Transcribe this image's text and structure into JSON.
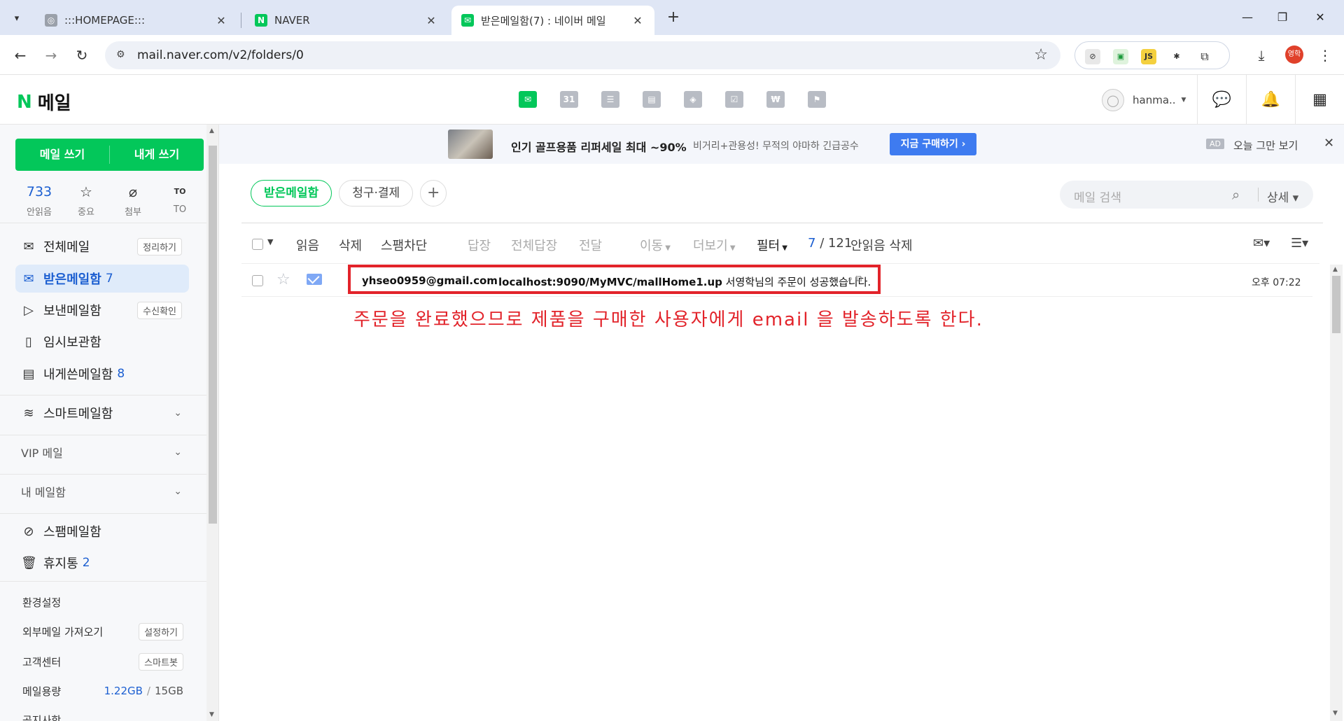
{
  "browser": {
    "tabs": [
      {
        "title": ":::HOMEPAGE:::",
        "favicon": "globe-icon"
      },
      {
        "title": "NAVER",
        "favicon": "naver-icon"
      },
      {
        "title": "받은메일함(7) : 네이버 메일",
        "favicon": "naver-mail-icon"
      }
    ],
    "url": "mail.naver.com/v2/folders/0",
    "profile_label": "영학"
  },
  "app": {
    "logo_letter": "N",
    "logo_text": "메일",
    "calendar_day": "31",
    "user_name": "hanma..",
    "brand_color": "#03c75a",
    "accent_color": "#1c5fd1"
  },
  "sidebar": {
    "write_button": "메일 쓰기",
    "write_self_button": "내게 쓰기",
    "quick": {
      "unread_count": "733",
      "unread_label": "안읽음",
      "important_label": "중요",
      "attach_label": "첨부",
      "to_badge": "TO",
      "to_label": "TO"
    },
    "folders": {
      "all": {
        "label": "전체메일",
        "badge": "정리하기"
      },
      "inbox": {
        "label": "받은메일함",
        "count": "7"
      },
      "sent": {
        "label": "보낸메일함",
        "badge": "수신확인"
      },
      "drafts": {
        "label": "임시보관함"
      },
      "self": {
        "label": "내게쓴메일함",
        "count": "8"
      },
      "smart": {
        "label": "스마트메일함"
      },
      "vip": {
        "label": "VIP 메일"
      },
      "my": {
        "label": "내 메일함"
      },
      "spam": {
        "label": "스팸메일함"
      },
      "trash": {
        "label": "휴지통",
        "count": "2"
      }
    },
    "settings": {
      "prefs": "환경설정",
      "external": "외부메일 가져오기",
      "external_badge": "설정하기",
      "support": "고객센터",
      "support_badge": "스마트봇",
      "quota_label": "메일용량",
      "quota_used": "1.22GB",
      "quota_sep": "/",
      "quota_total": "15GB",
      "notice": "공지사항"
    }
  },
  "ad": {
    "headline": "인기 골프용품 리퍼세일 최대 ~90%",
    "sub": "비거리+관용성! 무적의 야마하 긴급공수",
    "cta": "지금 구매하기 ›",
    "badge": "AD",
    "hide_today": "오늘 그만 보기"
  },
  "main": {
    "chips": [
      "받은메일함",
      "청구·결제"
    ],
    "search_placeholder": "메일 검색",
    "search_detail": "상세",
    "actions": {
      "read": "읽음",
      "delete": "삭제",
      "spam": "스팸차단",
      "reply": "답장",
      "reply_all": "전체답장",
      "forward": "전달",
      "move": "이동",
      "more": "더보기",
      "filter": "필터",
      "count_unread": "7",
      "count_total": "/ 121",
      "delete_unread": "안읽음 삭제"
    },
    "mails": [
      {
        "sender": "yhseo0959@gmail.com",
        "subject_bold": "localhost:9090/MyMVC/mallHome1.up",
        "subject_rest": "서영학님의 주문이 성공했습니다.",
        "time": "오후 07:22"
      }
    ],
    "annotation": "주문을 완료했으므로 제품을 구매한 사용자에게 email 을 발송하도록 한다."
  }
}
